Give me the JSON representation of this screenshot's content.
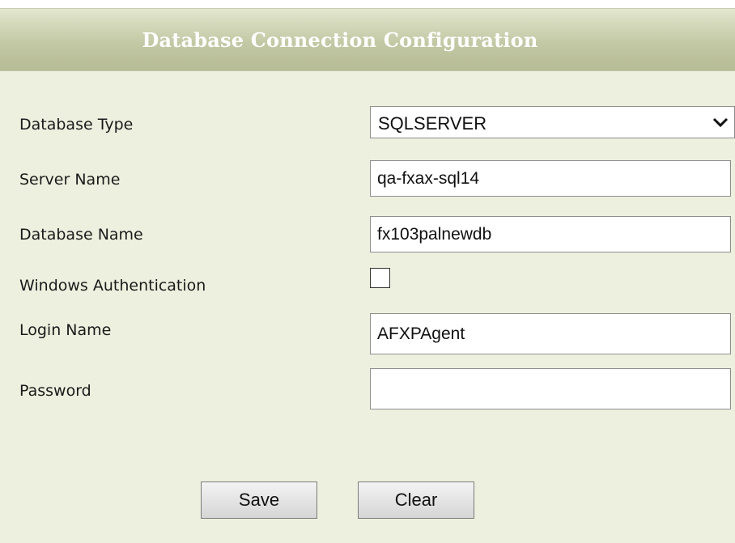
{
  "header": {
    "title": "Database Connection Configuration"
  },
  "form": {
    "database_type": {
      "label": "Database Type",
      "selected": "SQLSERVER"
    },
    "server_name": {
      "label": "Server Name",
      "value": "qa-fxax-sql14"
    },
    "database_name": {
      "label": "Database Name",
      "value": "fx103palnewdb"
    },
    "windows_auth": {
      "label": "Windows Authentication",
      "checked": false
    },
    "login_name": {
      "label": "Login Name",
      "value": "AFXPAgent"
    },
    "password": {
      "label": "Password",
      "value": ""
    }
  },
  "buttons": {
    "save_label": "Save",
    "clear_label": "Clear"
  },
  "colors": {
    "panel_bg": "#eef0df",
    "header_gradient_top": "#e3e7cf",
    "header_gradient_bottom": "#b6bc95",
    "header_text": "#ffffff"
  }
}
